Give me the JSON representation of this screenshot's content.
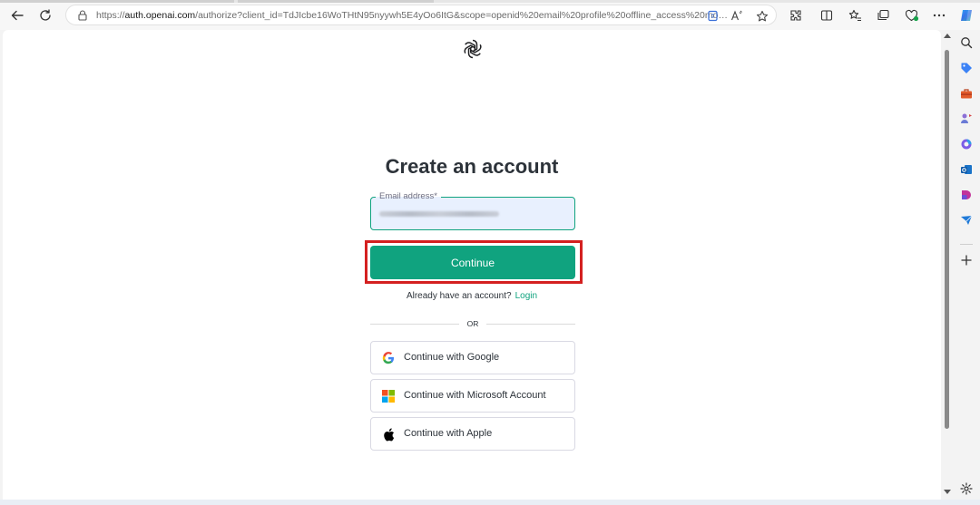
{
  "browser": {
    "url_prefix": "https://",
    "url_host": "auth.openai.com",
    "url_rest": "/authorize?client_id=TdJIcbe16WoTHtN95nyywh5E4yOo6ItG&scope=openid%20email%20profile%20offline_access%20model.r...",
    "icons": {
      "back": "back-arrow-icon",
      "refresh": "refresh-icon",
      "lock": "lock-icon",
      "read_aloud": "read-aloud-icon",
      "favorite": "star-icon",
      "extensions": "puzzle-icon",
      "split": "split-screen-icon",
      "favorites": "favorites-icon",
      "collections": "collections-icon",
      "more": "more-icon",
      "copilot": "copilot-icon"
    }
  },
  "page": {
    "title": "Create an account",
    "email_label": "Email address*",
    "continue_label": "Continue",
    "login_prompt": "Already have an account?",
    "login_link": "Login",
    "or_text": "OR",
    "social": [
      {
        "label": "Continue with Google",
        "icon": "google-icon"
      },
      {
        "label": "Continue with Microsoft Account",
        "icon": "microsoft-icon"
      },
      {
        "label": "Continue with Apple",
        "icon": "apple-icon"
      }
    ]
  },
  "colors": {
    "accent": "#10a37f",
    "highlight": "#d42020",
    "title": "#2d333a"
  }
}
